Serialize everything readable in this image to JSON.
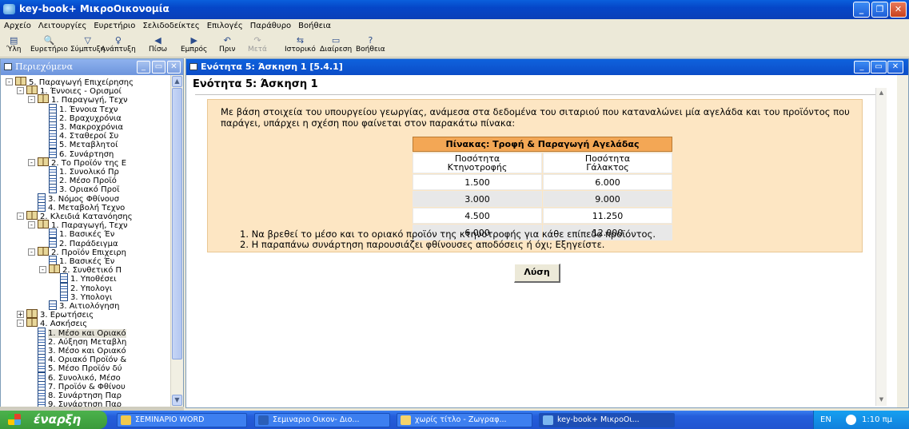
{
  "window": {
    "title": "key-book+ ΜικροΟικονομία"
  },
  "menu": [
    "Αρχείο",
    "Λειτουργίες",
    "Ευρετήριο",
    "Σελιδοδείκτες",
    "Επιλογές",
    "Παράθυρο",
    "Βοήθεια"
  ],
  "toolbar": [
    {
      "label": "Ύλη",
      "icon": "contents-icon",
      "glyph": "▤",
      "enabled": true
    },
    {
      "label": "Ευρετήριο",
      "icon": "search-icon",
      "glyph": "🔍",
      "enabled": true
    },
    {
      "label": "Σύμπτυξη",
      "icon": "collapse-icon",
      "glyph": "▽",
      "enabled": true
    },
    {
      "label": "Ανάπτυξη",
      "icon": "expand-icon",
      "glyph": "♀",
      "enabled": true
    },
    {
      "label": "Πίσω",
      "icon": "back-icon",
      "glyph": "◀",
      "enabled": true
    },
    {
      "label": "Εμπρός",
      "icon": "forward-icon",
      "glyph": "▶",
      "enabled": true
    },
    {
      "label": "Πριν",
      "icon": "undo-icon",
      "glyph": "↶",
      "enabled": true
    },
    {
      "label": "Μετά",
      "icon": "redo-icon",
      "glyph": "↷",
      "enabled": false
    },
    {
      "label": "Ιστορικό",
      "icon": "history-icon",
      "glyph": "⇆",
      "enabled": true
    },
    {
      "label": "Διαίρεση",
      "icon": "split-icon",
      "glyph": "▭",
      "enabled": true
    },
    {
      "label": "Βοήθεια",
      "icon": "help-icon",
      "glyph": "?",
      "enabled": true
    }
  ],
  "left_pane": {
    "title": "Περιεχόμενα",
    "tree": [
      {
        "text": "5. Παραγωγή Επιχείρησης",
        "level": 0,
        "type": "book",
        "exp": "-"
      },
      {
        "text": "1. Έννοιες - Ορισμοί",
        "level": 1,
        "type": "book",
        "exp": "-"
      },
      {
        "text": "1. Παραγωγή, Τεχν",
        "level": 2,
        "type": "book",
        "exp": "-"
      },
      {
        "text": "1. Έννοια Τεχν",
        "level": 3,
        "type": "page"
      },
      {
        "text": "2. Βραχυχρόνια",
        "level": 3,
        "type": "page"
      },
      {
        "text": "3. Μακροχρόνια",
        "level": 3,
        "type": "page"
      },
      {
        "text": "4. Σταθεροί Συ",
        "level": 3,
        "type": "page"
      },
      {
        "text": "5. Μεταβλητοί",
        "level": 3,
        "type": "page"
      },
      {
        "text": "6. Συνάρτηση",
        "level": 3,
        "type": "page"
      },
      {
        "text": "2. Το Προϊόν της Ε",
        "level": 2,
        "type": "book",
        "exp": "-"
      },
      {
        "text": "1. Συνολικό Πρ",
        "level": 3,
        "type": "page"
      },
      {
        "text": "2. Μέσο Προϊό",
        "level": 3,
        "type": "page"
      },
      {
        "text": "3. Οριακό Προϊ",
        "level": 3,
        "type": "page"
      },
      {
        "text": "3. Νόμος Φθίνουσ",
        "level": 2,
        "type": "page"
      },
      {
        "text": "4. Μεταβολή Τεχνο",
        "level": 2,
        "type": "page"
      },
      {
        "text": "2. Κλειδιά Κατανόησης",
        "level": 1,
        "type": "book",
        "exp": "-"
      },
      {
        "text": "1. Παραγωγή, Τεχν",
        "level": 2,
        "type": "book",
        "exp": "-"
      },
      {
        "text": "1. Βασικές Έν",
        "level": 3,
        "type": "page"
      },
      {
        "text": "2. Παράδειγμα",
        "level": 3,
        "type": "page"
      },
      {
        "text": "2. Προϊόν Επιχειρη",
        "level": 2,
        "type": "book",
        "exp": "-"
      },
      {
        "text": "1. Βασικές Έν",
        "level": 3,
        "type": "page"
      },
      {
        "text": "2. Συνθετικό Π",
        "level": 3,
        "type": "book",
        "exp": "-"
      },
      {
        "text": "1. Υποθέσει",
        "level": 4,
        "type": "page"
      },
      {
        "text": "2. Υπολογι",
        "level": 4,
        "type": "page"
      },
      {
        "text": "3. Υπολογι",
        "level": 4,
        "type": "page"
      },
      {
        "text": "3. Αιτιολόγηση",
        "level": 3,
        "type": "page"
      },
      {
        "text": "3. Ερωτήσεις",
        "level": 1,
        "type": "stack",
        "exp": "+"
      },
      {
        "text": "4. Ασκήσεις",
        "level": 1,
        "type": "book",
        "exp": "-"
      },
      {
        "text": "1. Μέσο και Οριακό",
        "level": 2,
        "type": "page",
        "selected": true
      },
      {
        "text": "2. Αύξηση Μεταβλη",
        "level": 2,
        "type": "page"
      },
      {
        "text": "3. Μέσο και Οριακό",
        "level": 2,
        "type": "page"
      },
      {
        "text": "4. Οριακό Προϊόν &",
        "level": 2,
        "type": "page"
      },
      {
        "text": "5. Μέσο Προϊόν δύ",
        "level": 2,
        "type": "page"
      },
      {
        "text": "6. Συνολικό, Μέσο",
        "level": 2,
        "type": "page"
      },
      {
        "text": "7. Προϊόν & Φθίνου",
        "level": 2,
        "type": "page"
      },
      {
        "text": "8. Συνάρτηση Παρ",
        "level": 2,
        "type": "page"
      },
      {
        "text": "9. Συνάρτηση Παρ",
        "level": 2,
        "type": "page"
      }
    ]
  },
  "right_pane": {
    "title": "Ενότητα 5: Άσκηση 1   [5.4.1]",
    "heading": "Ενότητα 5: Άσκηση 1",
    "intro": "Με βάση στοιχεία του υπουργείου γεωργίας, ανάμεσα στα δεδομένα του σιταριού που καταναλώνει μία αγελάδα και του προϊόντος που παράγει, υπάρχει η σχέση που φαίνεται στον παρακάτω πίνακα:",
    "table": {
      "caption": "Πίνακας: Τροφή & Παραγωγή Αγελάδας",
      "col1": [
        "Ποσότητα",
        "Κτηνοτροφής"
      ],
      "col2": [
        "Ποσότητα",
        "Γάλακτος"
      ],
      "rows": [
        [
          "1.500",
          "6.000"
        ],
        [
          "3.000",
          "9.000"
        ],
        [
          "4.500",
          "11.250"
        ],
        [
          "6.000",
          "12.000"
        ]
      ]
    },
    "questions": [
      "1.  Να βρεθεί το μέσο και το οριακό προϊόν της κτηνοτροφής για κάθε επίπεδο προϊόντος.",
      "2.  Η παραπάνω συνάρτηση παρουσιάζει φθίνουσες αποδόσεις ή όχι; Εξηγείστε."
    ],
    "solve_button": "Λύση"
  },
  "taskbar": {
    "start": "έναρξη",
    "tasks": [
      {
        "label": "ΣΕΜΙΝΑΡΙΟ WORD",
        "color": "#f2c94c"
      },
      {
        "label": "Σεμιναριο Οικον- Διο...",
        "color": "#2b5fb8"
      },
      {
        "label": "χωρίς τίτλο - Ζωγραφ...",
        "color": "#f5d36a"
      },
      {
        "label": "key-book+ ΜικροΟι...",
        "color": "#7bb7f0",
        "active": true
      }
    ],
    "lang": "EN",
    "time": "1:10 πμ"
  }
}
